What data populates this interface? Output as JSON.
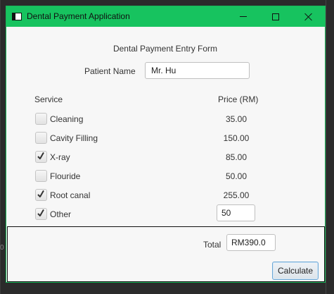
{
  "window": {
    "title": "Dental Payment Application"
  },
  "form": {
    "title": "Dental Payment Entry Form",
    "patient_label": "Patient Name",
    "patient_value": "Mr. Hu",
    "service_header": "Service",
    "price_header": "Price (RM)"
  },
  "services": [
    {
      "label": "Cleaning",
      "price": "35.00",
      "checked": false
    },
    {
      "label": "Cavity Filling",
      "price": "150.00",
      "checked": false
    },
    {
      "label": "X-ray",
      "price": "85.00",
      "checked": true
    },
    {
      "label": "Flouride",
      "price": "50.00",
      "checked": false
    },
    {
      "label": "Root canal",
      "price": "255.00",
      "checked": true
    },
    {
      "label": "Other",
      "price": "50",
      "checked": true
    }
  ],
  "total": {
    "label": "Total",
    "value": "RM390.0"
  },
  "calculate_label": "Calculate",
  "background": {
    "edge_text": "0"
  },
  "colors": {
    "titlebar": "#17c35f",
    "window_bg": "#f4f4f4",
    "button_border": "#6aa7d6"
  }
}
